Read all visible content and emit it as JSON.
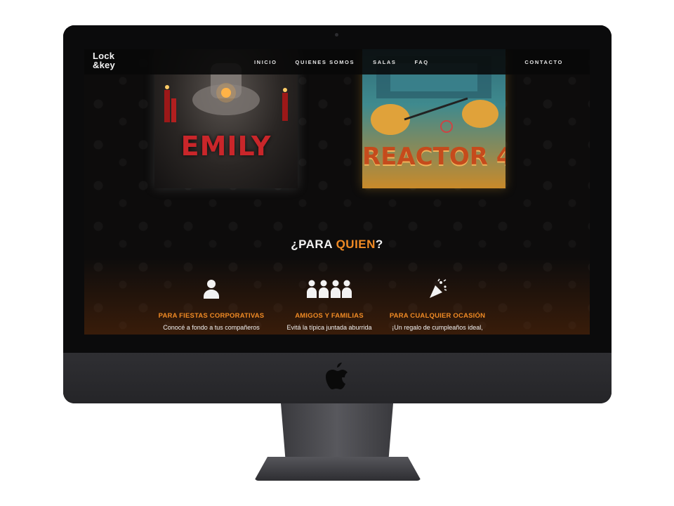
{
  "nav": {
    "logo_line1": "Lock",
    "logo_line2": "&key",
    "links": [
      "INICIO",
      "QUIENES SOMOS",
      "SALAS",
      "FAQ"
    ],
    "contact": "CONTACTO"
  },
  "rooms": [
    {
      "title": "EMILY"
    },
    {
      "title": "REACTOR 4"
    }
  ],
  "section": {
    "title_prefix": "¿PARA ",
    "title_accent": "QUIEN",
    "title_suffix": "?"
  },
  "features": [
    {
      "icon": "person-icon",
      "title": "PARA FIESTAS CORPORATIVAS",
      "text": "Conocé a fondo a tus compañeros"
    },
    {
      "icon": "group-icon",
      "title": "AMIGOS Y FAMILIAS",
      "text": "Evitá la típica juntada aburrida"
    },
    {
      "icon": "party-popper-icon",
      "title": "PARA CUALQUIER OCASIÓN",
      "text": "¡Un regalo de cumpleaños ideal,"
    }
  ],
  "colors": {
    "accent": "#f08a24",
    "background": "#0d0c0c"
  }
}
